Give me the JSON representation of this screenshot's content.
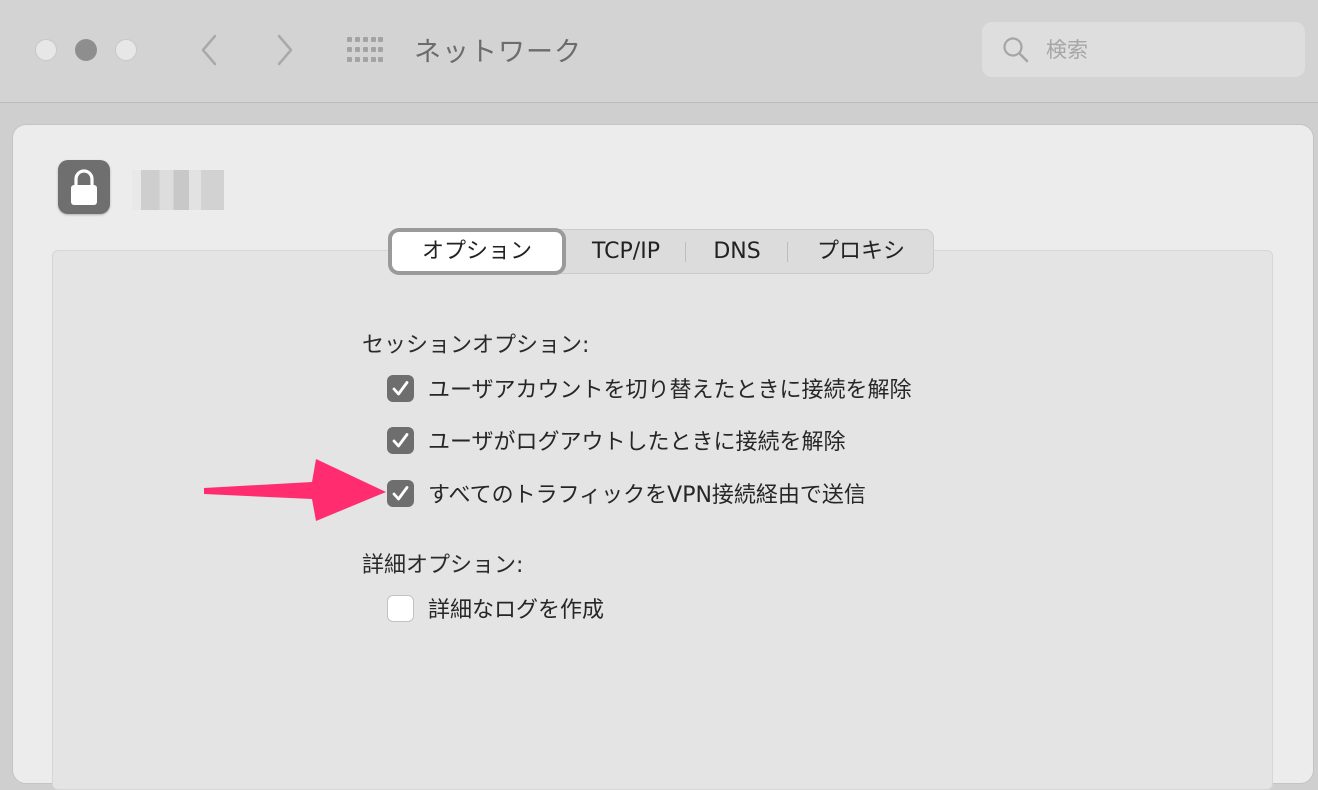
{
  "window": {
    "title": "ネットワーク",
    "search_placeholder": "検索"
  },
  "tabs": [
    {
      "label": "オプション",
      "selected": true
    },
    {
      "label": "TCP/IP",
      "selected": false
    },
    {
      "label": "DNS",
      "selected": false
    },
    {
      "label": "プロキシ",
      "selected": false
    }
  ],
  "session_options": {
    "heading": "セッションオプション:",
    "items": [
      {
        "label": "ユーザアカウントを切り替えたときに接続を解除",
        "checked": true
      },
      {
        "label": "ユーザがログアウトしたときに接続を解除",
        "checked": true
      },
      {
        "label": "すべてのトラフィックをVPN接続経由で送信",
        "checked": true
      }
    ]
  },
  "advanced_options": {
    "heading": "詳細オプション:",
    "items": [
      {
        "label": "詳細なログを作成",
        "checked": false
      }
    ]
  },
  "annotation": {
    "arrow_color": "#ff2d6f"
  },
  "colors": {
    "checkbox_on": "#6e6e6e",
    "panel_bg": "#ececec"
  }
}
